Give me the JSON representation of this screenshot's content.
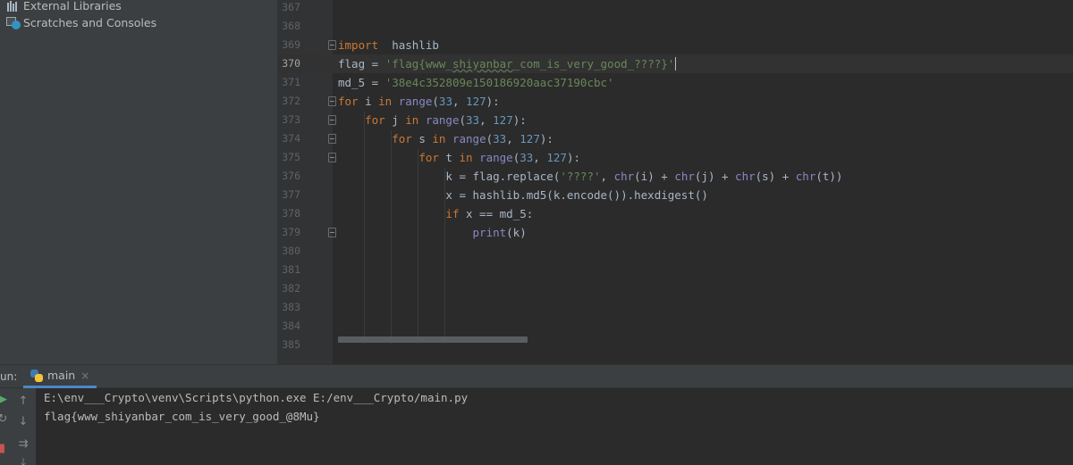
{
  "project": {
    "items": [
      {
        "label": "External Libraries",
        "icon": "library-icon"
      },
      {
        "label": "Scratches and Consoles",
        "icon": "scratches-icon"
      }
    ]
  },
  "editor": {
    "current_line": 370,
    "lines": [
      {
        "num": "367"
      },
      {
        "num": "368"
      },
      {
        "num": "369",
        "t": [
          [
            "kw",
            "import"
          ],
          [
            "",
            "  hashlib"
          ]
        ]
      },
      {
        "num": "370",
        "t": [
          [
            "",
            "flag = "
          ],
          [
            "str",
            "'flag{www_"
          ],
          [
            "str squig",
            "shiyanbar"
          ],
          [
            "str",
            "_com_is_very_good_????}'"
          ]
        ]
      },
      {
        "num": "371",
        "t": [
          [
            "",
            "md_5 = "
          ],
          [
            "str",
            "'38e4c352809e150186920aac37190cbc'"
          ]
        ]
      },
      {
        "num": "372",
        "t": [
          [
            "kw",
            "for"
          ],
          [
            "",
            " i "
          ],
          [
            "kw",
            "in"
          ],
          [
            "",
            " "
          ],
          [
            "bi",
            "range"
          ],
          [
            "",
            "("
          ],
          [
            "num",
            "33"
          ],
          [
            "",
            ", "
          ],
          [
            "num",
            "127"
          ],
          [
            "",
            "):"
          ]
        ]
      },
      {
        "num": "373",
        "t": [
          [
            "",
            "    "
          ],
          [
            "kw",
            "for"
          ],
          [
            "",
            " j "
          ],
          [
            "kw",
            "in"
          ],
          [
            "",
            " "
          ],
          [
            "bi",
            "range"
          ],
          [
            "",
            "("
          ],
          [
            "num",
            "33"
          ],
          [
            "",
            ", "
          ],
          [
            "num",
            "127"
          ],
          [
            "",
            "):"
          ]
        ]
      },
      {
        "num": "374",
        "t": [
          [
            "",
            "        "
          ],
          [
            "kw",
            "for"
          ],
          [
            "",
            " s "
          ],
          [
            "kw",
            "in"
          ],
          [
            "",
            " "
          ],
          [
            "bi",
            "range"
          ],
          [
            "",
            "("
          ],
          [
            "num",
            "33"
          ],
          [
            "",
            ", "
          ],
          [
            "num",
            "127"
          ],
          [
            "",
            "):"
          ]
        ]
      },
      {
        "num": "375",
        "t": [
          [
            "",
            "            "
          ],
          [
            "kw",
            "for"
          ],
          [
            "",
            " t "
          ],
          [
            "kw",
            "in"
          ],
          [
            "",
            " "
          ],
          [
            "bi",
            "range"
          ],
          [
            "",
            "("
          ],
          [
            "num",
            "33"
          ],
          [
            "",
            ", "
          ],
          [
            "num",
            "127"
          ],
          [
            "",
            "):"
          ]
        ]
      },
      {
        "num": "376",
        "t": [
          [
            "",
            "                k = flag.replace("
          ],
          [
            "str",
            "'????'"
          ],
          [
            "",
            ", "
          ],
          [
            "bi",
            "chr"
          ],
          [
            "",
            "(i) + "
          ],
          [
            "bi",
            "chr"
          ],
          [
            "",
            "(j) + "
          ],
          [
            "bi",
            "chr"
          ],
          [
            "",
            "(s) + "
          ],
          [
            "bi",
            "chr"
          ],
          [
            "",
            "(t))"
          ]
        ]
      },
      {
        "num": "377",
        "t": [
          [
            "",
            "                x = hashlib.md5(k.encode()).hexdigest()"
          ]
        ]
      },
      {
        "num": "378",
        "t": [
          [
            "",
            "                "
          ],
          [
            "kw",
            "if"
          ],
          [
            "",
            " x == md_5:"
          ]
        ]
      },
      {
        "num": "379",
        "t": [
          [
            "",
            "                    "
          ],
          [
            "bi",
            "print"
          ],
          [
            "",
            "(k)"
          ]
        ]
      },
      {
        "num": "380"
      },
      {
        "num": "381"
      },
      {
        "num": "382"
      },
      {
        "num": "383"
      },
      {
        "num": "384"
      },
      {
        "num": "385"
      }
    ]
  },
  "run": {
    "label": "un:",
    "tab_label": "main",
    "close_glyph": "×",
    "output": [
      "E:\\env___Crypto\\venv\\Scripts\\python.exe E:/env___Crypto/main.py",
      "flag{www_shiyanbar_com_is_very_good_@8Mu}"
    ]
  },
  "colors": {
    "editor_bg": "#2b2b2b",
    "panel_bg": "#3c3f41",
    "keyword": "#cc7832",
    "string": "#6a8759",
    "number": "#6897bb",
    "builtin": "#8888c6"
  }
}
